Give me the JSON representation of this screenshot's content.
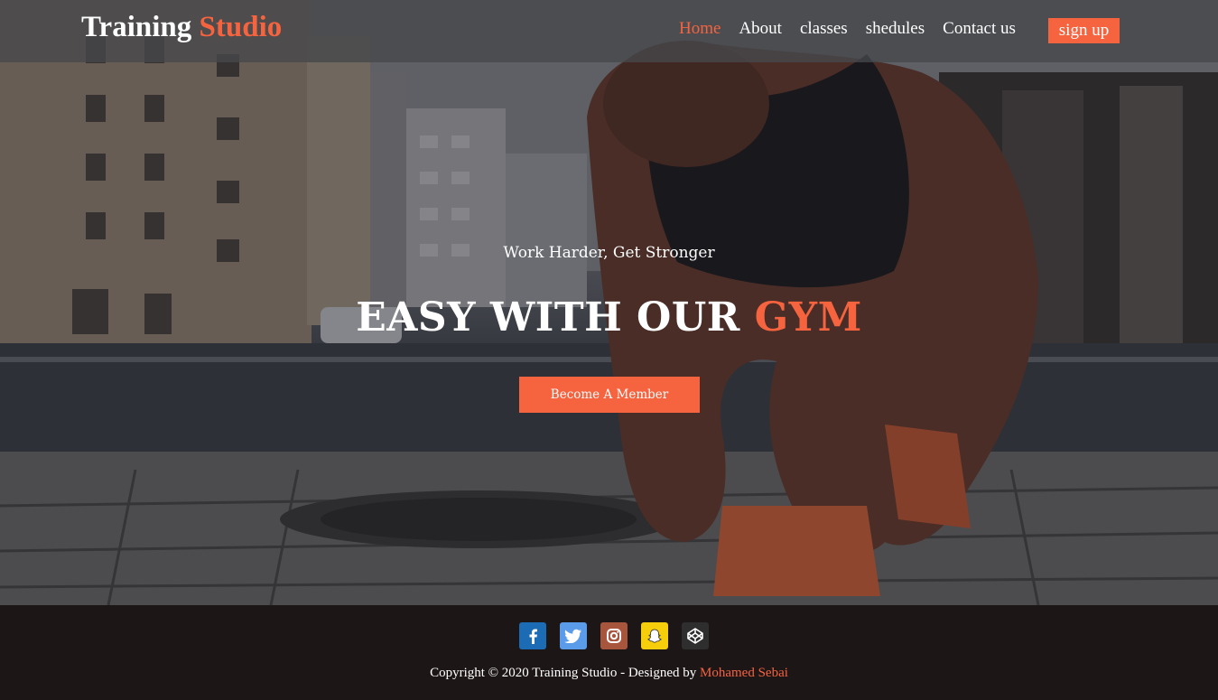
{
  "brand": {
    "name": "Training",
    "name_accent": "Studio"
  },
  "nav": {
    "items": [
      {
        "label": "Home",
        "active": true
      },
      {
        "label": "About",
        "active": false
      },
      {
        "label": "classes",
        "active": false
      },
      {
        "label": "shedules",
        "active": false
      },
      {
        "label": "Contact us",
        "active": false
      }
    ],
    "signup_label": "sign up"
  },
  "hero": {
    "tagline": "Work Harder, Get Stronger",
    "headline": "EASY WITH OUR",
    "headline_accent": "GYM",
    "cta_label": "Become A Member"
  },
  "footer": {
    "socials": [
      {
        "icon": "facebook-icon",
        "color": "#1b6cb5"
      },
      {
        "icon": "twitter-icon",
        "color": "#5a9bea"
      },
      {
        "icon": "instagram-icon",
        "color": "#a8553e"
      },
      {
        "icon": "snapchat-icon",
        "color": "#f6ce0b"
      },
      {
        "icon": "codepen-icon",
        "color": "#2e2e2e"
      }
    ],
    "copyright": "Copyright © 2020 Training Studio - Designed by",
    "author": "Mohamed Sebai"
  },
  "colors": {
    "accent": "#f5633f",
    "footer_bg": "#1d1617"
  }
}
